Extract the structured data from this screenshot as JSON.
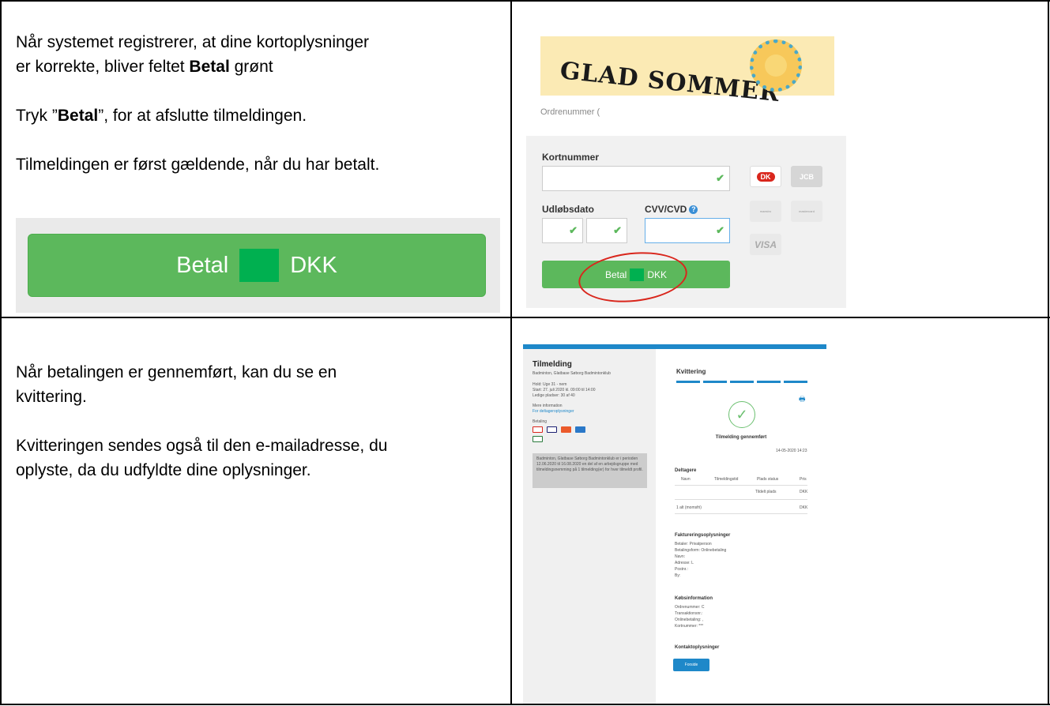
{
  "left_top": {
    "line1a": "Når systemet registrerer, at dine kortoplysninger",
    "line1b_pre": "er korrekte, bliver feltet ",
    "line1b_bold": "Betal",
    "line1b_post": " grønt",
    "line2_pre": "Tryk ”",
    "line2_bold": "Betal",
    "line2_post": "”, for at afslutte tilmeldingen.",
    "line3": "Tilmeldingen er først gældende, når du har betalt.",
    "pay_button": {
      "pre": "Betal",
      "post": "DKK"
    }
  },
  "payment_form": {
    "banner_text": "GLAD SOMMER",
    "order_label": "Ordrenummer (",
    "card_number_label": "Kortnummer",
    "expiry_label": "Udløbsdato",
    "cvv_label": "CVV/CVD",
    "help_glyph": "?",
    "check_glyph": "✔",
    "pay_button": {
      "pre": "Betal",
      "post": "DKK"
    },
    "cards": [
      "DK",
      "JCB",
      "maestro",
      "mastercard",
      "VISA"
    ]
  },
  "left_bottom": {
    "line1a": "Når betalingen er gennemført, kan du se en",
    "line1b": "kvittering.",
    "line2a": "Kvitteringen sendes også til den e-mailadresse, du",
    "line2b": "oplyste, da du udfyldte dine oplysninger."
  },
  "receipt": {
    "title": "Tilmelding",
    "org": "Badminton, Glatbase Søborg Badmintonklub",
    "hold": "Hold: Uge 31 - nem",
    "start": "Start: 27. juli 2020 kl. 09:00 til 14:00",
    "ledige": "Ledige pladser: 30 af 40",
    "mere_info": "Mere information",
    "mere_info_link": "For deltageroplysninger",
    "betaling": "Betaling",
    "note": "Badminton, Glatbase Søborg Badmintonklub er i perioden 12.06.2020 til 16.08.2020 en del af en arbejdsgruppe med tilmeldingsnemming på 1 tilmelding(er) for hver tilmeldt profil.",
    "kvittering": "Kvittering",
    "print_glyph": "🖶",
    "check_glyph": "✓",
    "status": "Tilmelding gennemført",
    "date": "14-05-2020 14:23",
    "deltagere": "Deltagere",
    "columns": [
      "Navn",
      "Tilmeldingstid",
      "Plads status",
      "Pris"
    ],
    "row_status": "Tildelt plads",
    "row_price": "DKK",
    "total_label": "1 alt (momsfri)",
    "total_price": "DKK",
    "fakt_title": "Faktureringsoplysninger",
    "fakt_lines": [
      "Betaler: Privatperson",
      "Betalingsform: Onlinebetaling",
      "Navn:",
      "Adresse: L",
      "Postnr.:",
      "By:"
    ],
    "kob_title": "Købsinformation",
    "kob_lines": [
      "Ordrenummer: C",
      "Transaktionsnr.:",
      "Onlinebetaling: ,",
      "Kortnummer: ***"
    ],
    "kontakt_title": "Kontaktoplysninger",
    "forside": "Forside"
  }
}
